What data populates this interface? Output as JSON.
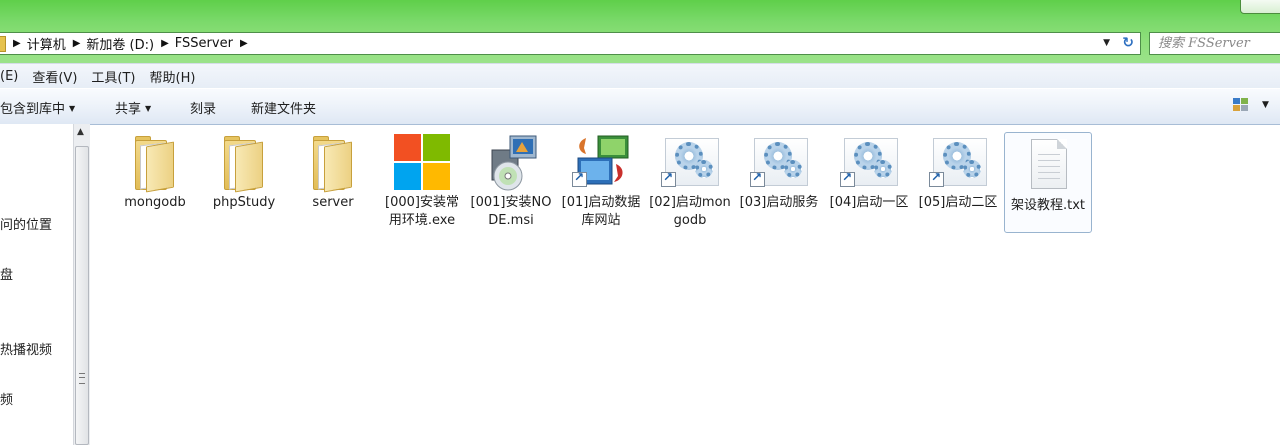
{
  "window": {
    "breadcrumb": [
      "计算机",
      "新加卷 (D:)",
      "FSServer"
    ],
    "search_placeholder": "搜索 FSServer"
  },
  "menubar": {
    "items": [
      "(E)",
      "查看(V)",
      "工具(T)",
      "帮助(H)"
    ]
  },
  "commandbar": {
    "include_library": "包含到库中",
    "share": "共享",
    "burn": "刻录",
    "new_folder": "新建文件夹",
    "dropdown_glyph": "▼"
  },
  "navpane": {
    "items": [
      "问的位置",
      "盘",
      "热播视频",
      "频"
    ]
  },
  "files": [
    {
      "name": "mongodb",
      "icon": "folder-icon"
    },
    {
      "name": "phpStudy",
      "icon": "folder-icon"
    },
    {
      "name": "server",
      "icon": "folder-icon"
    },
    {
      "name": "[000]安装常用环境.exe",
      "icon": "windows-logo-icon"
    },
    {
      "name": "[001]安装NODE.msi",
      "icon": "installer-icon"
    },
    {
      "name": "[01]启动数据库网站",
      "icon": "network-shortcut-icon"
    },
    {
      "name": "[02]启动mongodb",
      "icon": "gear-shortcut-icon"
    },
    {
      "name": "[03]启动服务",
      "icon": "gear-shortcut-icon"
    },
    {
      "name": "[04]启动一区",
      "icon": "gear-shortcut-icon"
    },
    {
      "name": "[05]启动二区",
      "icon": "gear-shortcut-icon"
    },
    {
      "name": "架设教程.txt",
      "icon": "text-file-icon",
      "selected": true
    }
  ],
  "colors": {
    "title_glass": "#7ad96a",
    "address_border": "#4e8f49",
    "selection_border": "#99b4cf",
    "win_red": "#f25022",
    "win_green": "#7fba00",
    "win_blue": "#00a4ef",
    "win_yellow": "#ffb900"
  }
}
